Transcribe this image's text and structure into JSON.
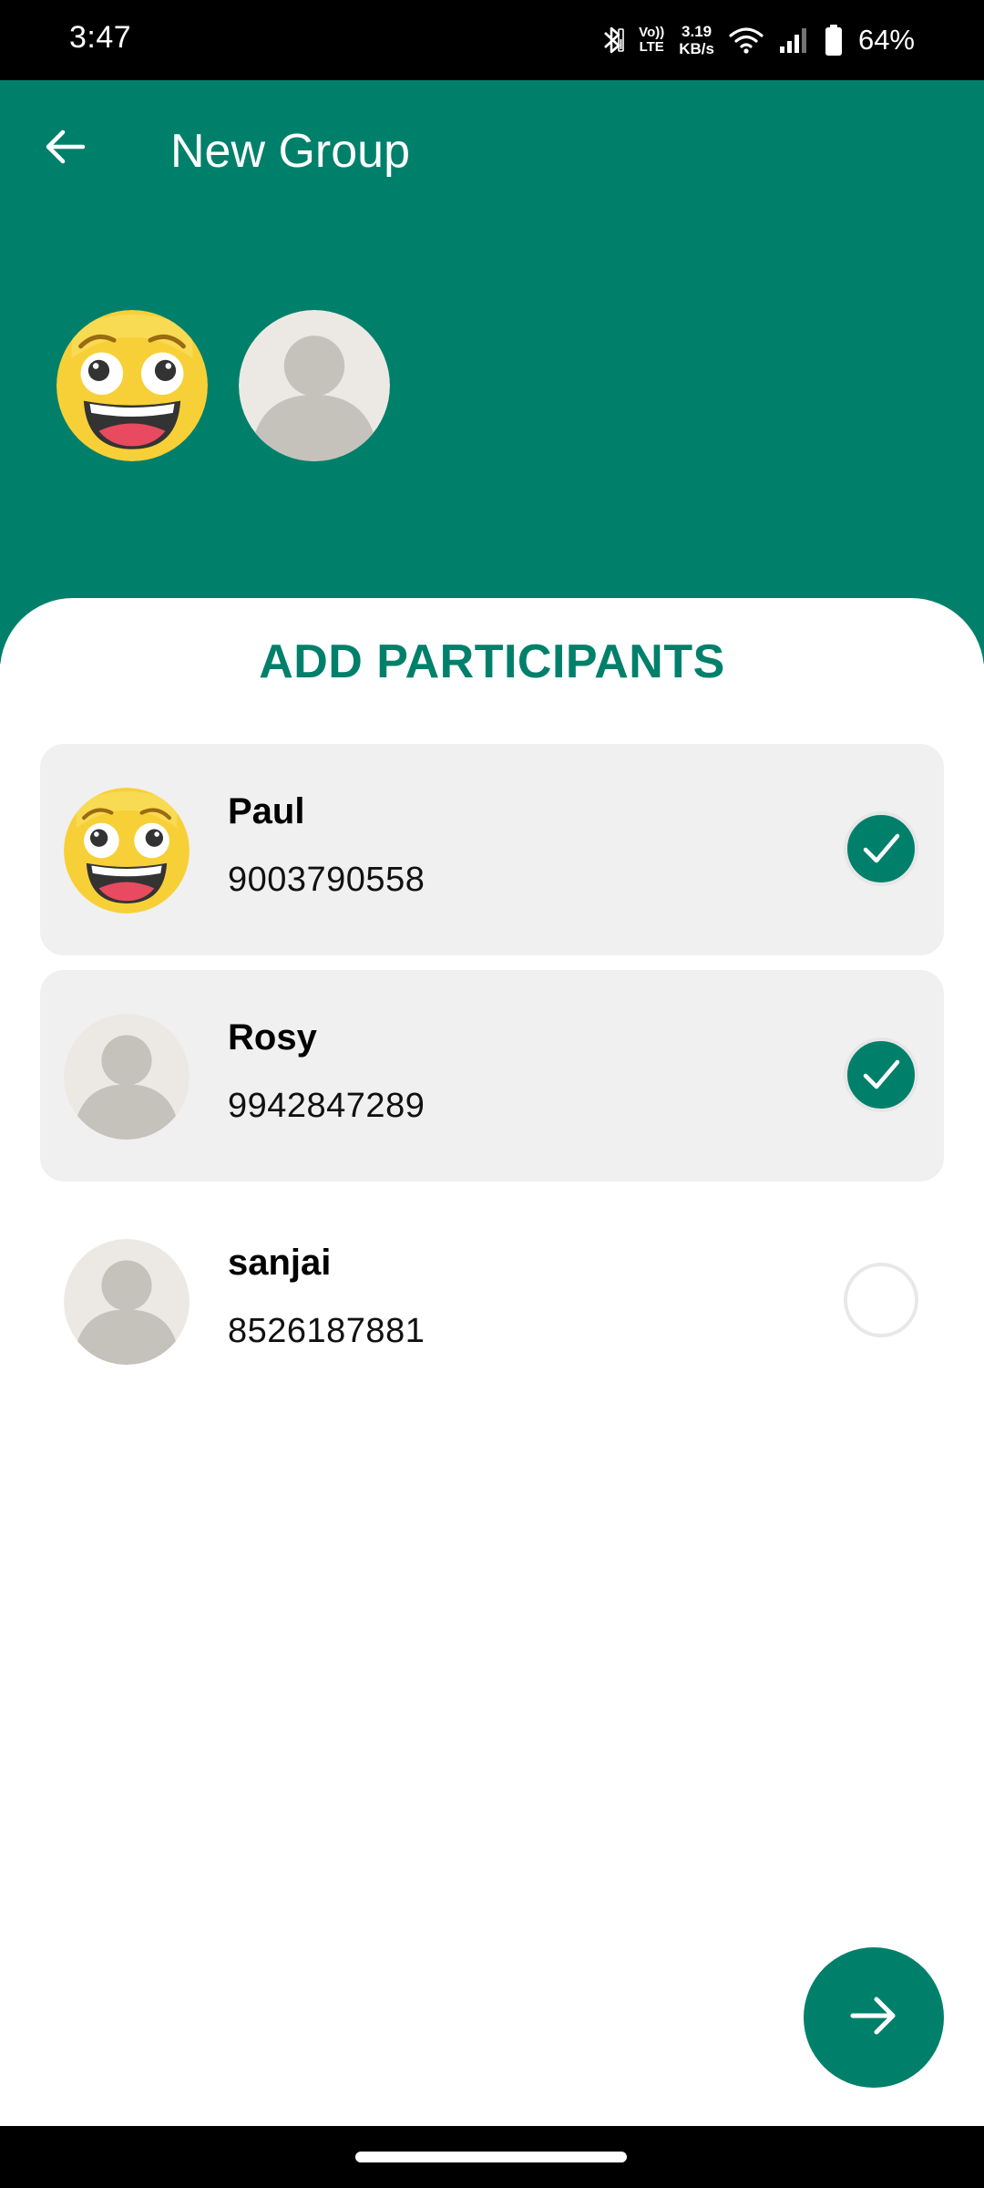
{
  "status_bar": {
    "time": "3:47",
    "volte_top": "Vo))",
    "volte_bottom": "LTE",
    "speed_value": "3.19",
    "speed_unit": "KB/s",
    "battery": "64%",
    "icons": [
      "bluetooth-icon",
      "volte-icon",
      "wifi-icon",
      "signal-icon",
      "battery-icon"
    ]
  },
  "header": {
    "title": "New Group",
    "back_icon": "arrow-left-icon",
    "selected_participants": [
      {
        "avatar": "laughing-emoji-avatar"
      },
      {
        "avatar": "default-person-avatar"
      }
    ]
  },
  "participants": {
    "title": "ADD PARTICIPANTS",
    "contacts": [
      {
        "name": "Paul",
        "phone": "9003790558",
        "avatar": "laughing-emoji-avatar",
        "selected": true
      },
      {
        "name": "Rosy",
        "phone": "9942847289",
        "avatar": "default-person-avatar",
        "selected": true
      },
      {
        "name": "sanjai",
        "phone": "8526187881",
        "avatar": "default-person-avatar",
        "selected": false
      }
    ]
  },
  "fab": {
    "icon": "arrow-right-icon"
  },
  "colors": {
    "primary": "#00806b",
    "selected_row_bg": "#f0f0f0",
    "emoji_yellow": "#f7d038",
    "avatar_bg": "#ece9e4",
    "avatar_figure": "#c5c2bc"
  }
}
